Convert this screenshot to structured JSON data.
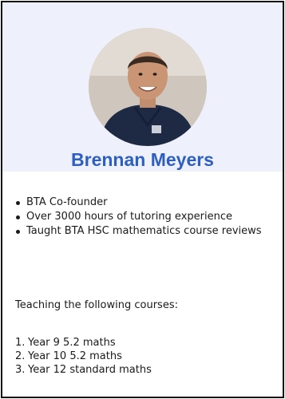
{
  "profile": {
    "name": "Brennan Meyers",
    "avatar_icon": "profile-photo"
  },
  "highlights": [
    {
      "label": "BTA Co-founder"
    },
    {
      "label": "Over 3000 hours of tutoring experience"
    },
    {
      "label": "Taught BTA HSC mathematics course reviews"
    }
  ],
  "courses_heading": "Teaching the following courses:",
  "courses": [
    {
      "num": "1.",
      "label": "Year 9 5.2 maths"
    },
    {
      "num": "2.",
      "label": "Year 10 5.2 maths"
    },
    {
      "num": "3.",
      "label": "Year 12 standard maths"
    }
  ],
  "colors": {
    "name_text": "#2e5fbf",
    "header_bg": "#eef1fb",
    "border": "#111111"
  }
}
